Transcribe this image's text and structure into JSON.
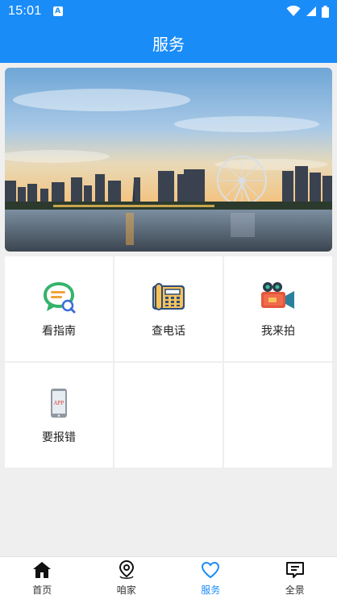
{
  "status_bar": {
    "time": "15:01",
    "notification_icon": "A"
  },
  "header": {
    "title": "服务"
  },
  "banner": {
    "icon": "city-skyline-photo"
  },
  "services": [
    {
      "label": "看指南",
      "icon": "chat-search-icon"
    },
    {
      "label": "查电话",
      "icon": "telephone-icon"
    },
    {
      "label": "我来拍",
      "icon": "video-camera-icon"
    },
    {
      "label": "要报错",
      "icon": "phone-app-icon",
      "badge": "APP"
    }
  ],
  "tabbar": {
    "items": [
      {
        "label": "首页",
        "icon": "home-icon"
      },
      {
        "label": "咱家",
        "icon": "location-pin-icon"
      },
      {
        "label": "服务",
        "icon": "heart-icon",
        "active": true
      },
      {
        "label": "全景",
        "icon": "message-list-icon"
      }
    ]
  },
  "colors": {
    "primary": "#1a8cf8",
    "active_tab": "#1a8cf8"
  }
}
